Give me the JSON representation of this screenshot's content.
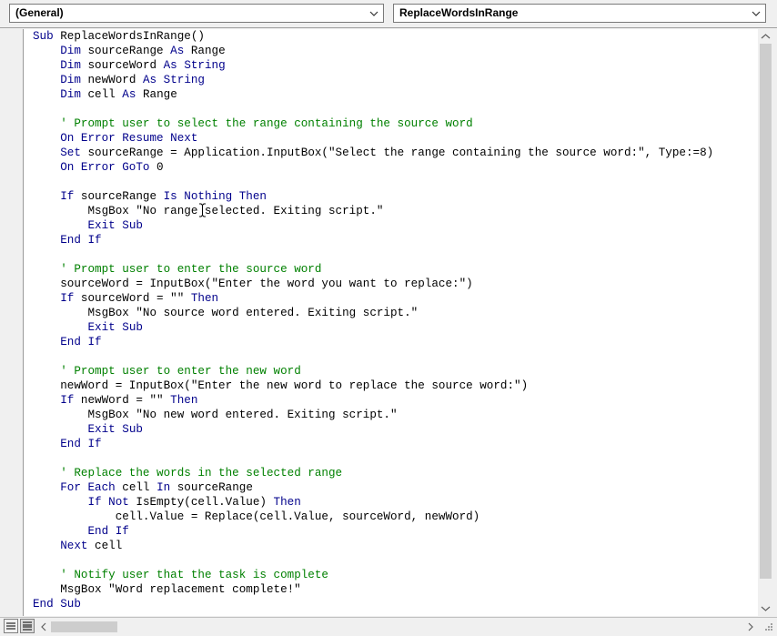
{
  "toolbar": {
    "object_combo": "(General)",
    "procedure_combo": "ReplaceWordsInRange"
  },
  "colors": {
    "keyword": "#00008b",
    "comment": "#008000",
    "plain": "#000000",
    "scroll_thumb": "#cdcdcd"
  },
  "icons": {
    "combo_arrow": "chevron-down-icon",
    "scroll_up": "scroll-up-arrow-icon",
    "scroll_down": "scroll-down-arrow-icon",
    "scroll_left": "scroll-left-arrow-icon",
    "scroll_right": "scroll-right-arrow-icon",
    "procedure_view": "procedure-view-icon",
    "full_module_view": "full-module-view-icon",
    "cursor": "ibeam-cursor-icon",
    "grip": "resize-grip-icon"
  },
  "code": {
    "lines": [
      [
        {
          "t": "k",
          "v": "Sub"
        },
        {
          "t": "p",
          "v": " ReplaceWordsInRange()"
        }
      ],
      [
        {
          "t": "p",
          "v": "    "
        },
        {
          "t": "k",
          "v": "Dim"
        },
        {
          "t": "p",
          "v": " sourceRange "
        },
        {
          "t": "k",
          "v": "As"
        },
        {
          "t": "p",
          "v": " Range"
        }
      ],
      [
        {
          "t": "p",
          "v": "    "
        },
        {
          "t": "k",
          "v": "Dim"
        },
        {
          "t": "p",
          "v": " sourceWord "
        },
        {
          "t": "k",
          "v": "As"
        },
        {
          "t": "p",
          "v": " "
        },
        {
          "t": "k",
          "v": "String"
        }
      ],
      [
        {
          "t": "p",
          "v": "    "
        },
        {
          "t": "k",
          "v": "Dim"
        },
        {
          "t": "p",
          "v": " newWord "
        },
        {
          "t": "k",
          "v": "As"
        },
        {
          "t": "p",
          "v": " "
        },
        {
          "t": "k",
          "v": "String"
        }
      ],
      [
        {
          "t": "p",
          "v": "    "
        },
        {
          "t": "k",
          "v": "Dim"
        },
        {
          "t": "p",
          "v": " cell "
        },
        {
          "t": "k",
          "v": "As"
        },
        {
          "t": "p",
          "v": " Range"
        }
      ],
      [],
      [
        {
          "t": "p",
          "v": "    "
        },
        {
          "t": "c",
          "v": "' Prompt user to select the range containing the source word"
        }
      ],
      [
        {
          "t": "p",
          "v": "    "
        },
        {
          "t": "k",
          "v": "On Error Resume Next"
        }
      ],
      [
        {
          "t": "p",
          "v": "    "
        },
        {
          "t": "k",
          "v": "Set"
        },
        {
          "t": "p",
          "v": " sourceRange = Application.InputBox(\"Select the range containing the source word:\", Type:=8)"
        }
      ],
      [
        {
          "t": "p",
          "v": "    "
        },
        {
          "t": "k",
          "v": "On Error GoTo"
        },
        {
          "t": "p",
          "v": " 0"
        }
      ],
      [],
      [
        {
          "t": "p",
          "v": "    "
        },
        {
          "t": "k",
          "v": "If"
        },
        {
          "t": "p",
          "v": " sourceRange "
        },
        {
          "t": "k",
          "v": "Is Nothing Then"
        }
      ],
      [
        {
          "t": "p",
          "v": "        MsgBox \"No range selected. Exiting script.\""
        }
      ],
      [
        {
          "t": "p",
          "v": "        "
        },
        {
          "t": "k",
          "v": "Exit Sub"
        }
      ],
      [
        {
          "t": "p",
          "v": "    "
        },
        {
          "t": "k",
          "v": "End If"
        }
      ],
      [],
      [
        {
          "t": "p",
          "v": "    "
        },
        {
          "t": "c",
          "v": "' Prompt user to enter the source word"
        }
      ],
      [
        {
          "t": "p",
          "v": "    sourceWord = InputBox(\"Enter the word you want to replace:\")"
        }
      ],
      [
        {
          "t": "p",
          "v": "    "
        },
        {
          "t": "k",
          "v": "If"
        },
        {
          "t": "p",
          "v": " sourceWord = \"\" "
        },
        {
          "t": "k",
          "v": "Then"
        }
      ],
      [
        {
          "t": "p",
          "v": "        MsgBox \"No source word entered. Exiting script.\""
        }
      ],
      [
        {
          "t": "p",
          "v": "        "
        },
        {
          "t": "k",
          "v": "Exit Sub"
        }
      ],
      [
        {
          "t": "p",
          "v": "    "
        },
        {
          "t": "k",
          "v": "End If"
        }
      ],
      [],
      [
        {
          "t": "p",
          "v": "    "
        },
        {
          "t": "c",
          "v": "' Prompt user to enter the new word"
        }
      ],
      [
        {
          "t": "p",
          "v": "    newWord = InputBox(\"Enter the new word to replace the source word:\")"
        }
      ],
      [
        {
          "t": "p",
          "v": "    "
        },
        {
          "t": "k",
          "v": "If"
        },
        {
          "t": "p",
          "v": " newWord = \"\" "
        },
        {
          "t": "k",
          "v": "Then"
        }
      ],
      [
        {
          "t": "p",
          "v": "        MsgBox \"No new word entered. Exiting script.\""
        }
      ],
      [
        {
          "t": "p",
          "v": "        "
        },
        {
          "t": "k",
          "v": "Exit Sub"
        }
      ],
      [
        {
          "t": "p",
          "v": "    "
        },
        {
          "t": "k",
          "v": "End If"
        }
      ],
      [],
      [
        {
          "t": "p",
          "v": "    "
        },
        {
          "t": "c",
          "v": "' Replace the words in the selected range"
        }
      ],
      [
        {
          "t": "p",
          "v": "    "
        },
        {
          "t": "k",
          "v": "For Each"
        },
        {
          "t": "p",
          "v": " cell "
        },
        {
          "t": "k",
          "v": "In"
        },
        {
          "t": "p",
          "v": " sourceRange"
        }
      ],
      [
        {
          "t": "p",
          "v": "        "
        },
        {
          "t": "k",
          "v": "If Not"
        },
        {
          "t": "p",
          "v": " IsEmpty(cell.Value) "
        },
        {
          "t": "k",
          "v": "Then"
        }
      ],
      [
        {
          "t": "p",
          "v": "            cell.Value = Replace(cell.Value, sourceWord, newWord)"
        }
      ],
      [
        {
          "t": "p",
          "v": "        "
        },
        {
          "t": "k",
          "v": "End If"
        }
      ],
      [
        {
          "t": "p",
          "v": "    "
        },
        {
          "t": "k",
          "v": "Next"
        },
        {
          "t": "p",
          "v": " cell"
        }
      ],
      [],
      [
        {
          "t": "p",
          "v": "    "
        },
        {
          "t": "c",
          "v": "' Notify user that the task is complete"
        }
      ],
      [
        {
          "t": "p",
          "v": "    MsgBox \"Word replacement complete!\""
        }
      ],
      [
        {
          "t": "k",
          "v": "End Sub"
        }
      ]
    ]
  }
}
